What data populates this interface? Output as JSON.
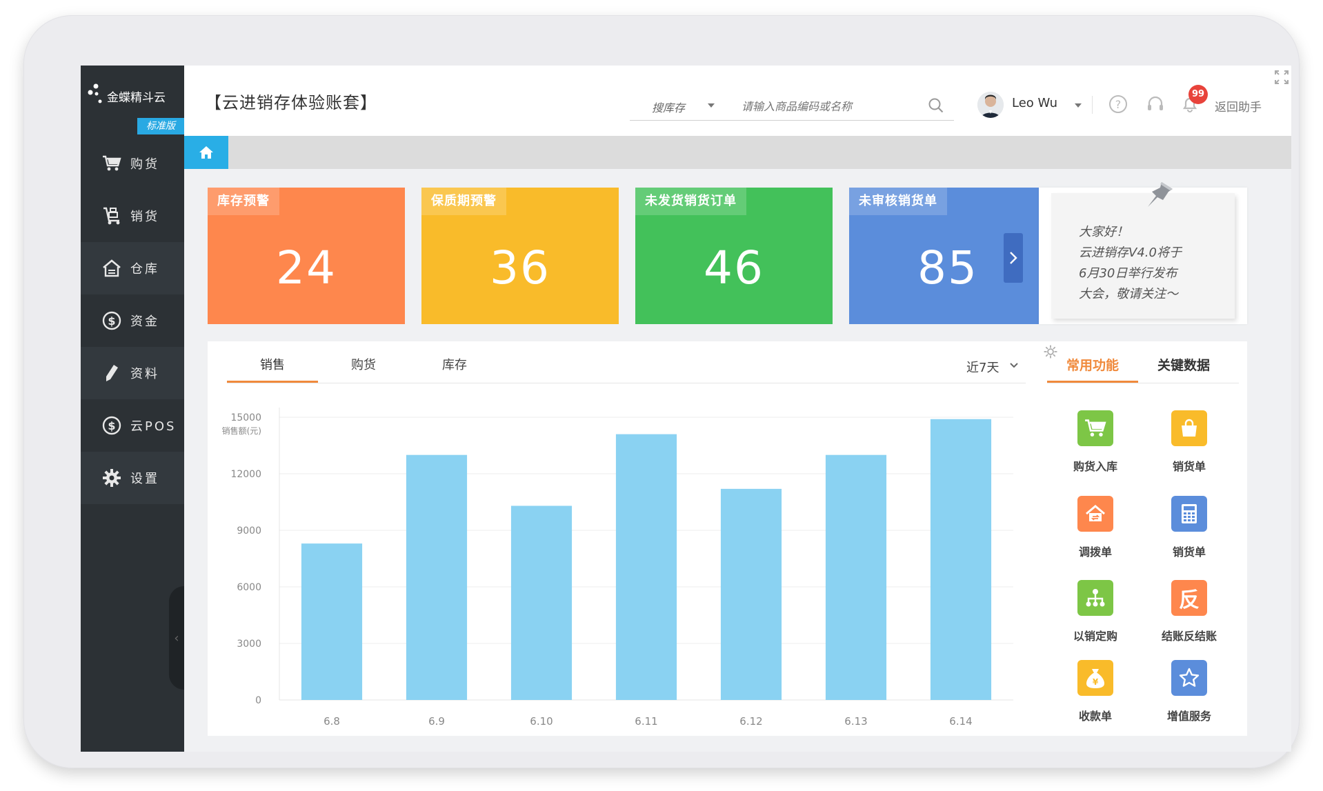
{
  "app": {
    "logo_text": "金蝶精斗云",
    "edition": "标准版",
    "title": "【云进销存体验账套】"
  },
  "sidebar": {
    "items": [
      {
        "label": "购货",
        "icon": "cart-icon"
      },
      {
        "label": "销货",
        "icon": "trolley-icon"
      },
      {
        "label": "仓库",
        "icon": "warehouse-icon"
      },
      {
        "label": "资金",
        "icon": "dollar-icon"
      },
      {
        "label": "资料",
        "icon": "pencil-icon"
      },
      {
        "label": "云POS",
        "icon": "dollar-icon"
      },
      {
        "label": "设置",
        "icon": "gear-icon"
      }
    ]
  },
  "header": {
    "search_scope": "搜库存",
    "search_placeholder": "请输入商品编码或名称",
    "user_name": "Leo Wu",
    "notification_count": "99",
    "assistant_label": "返回助手"
  },
  "cards": [
    {
      "label": "库存预警",
      "value": "24",
      "color": "#fe874d"
    },
    {
      "label": "保质期预警",
      "value": "36",
      "color": "#f9bb2a"
    },
    {
      "label": "未发货销货订单",
      "value": "46",
      "color": "#43c15a"
    },
    {
      "label": "未审核销货单",
      "value": "85",
      "color": "#5b8ddb"
    }
  ],
  "notice": {
    "lines": [
      "大家好！",
      "云进销存V4.0将于",
      "6月30日举行发布",
      "大会，敬请关注～"
    ]
  },
  "chart_tabs": [
    "销售",
    "购货",
    "库存"
  ],
  "chart_period": "近7天",
  "chart_data": {
    "type": "bar",
    "categories": [
      "6.8",
      "6.9",
      "6.10",
      "6.11",
      "6.12",
      "6.13",
      "6.14"
    ],
    "values": [
      8300,
      13000,
      10300,
      14100,
      11200,
      13000,
      14900
    ],
    "ylabel": "销售额(元)",
    "ylim": [
      0,
      15000
    ],
    "yticks": [
      0,
      3000,
      6000,
      9000,
      12000,
      15000
    ],
    "grid": true,
    "bar_color": "#8ad2f2"
  },
  "quick_panel": {
    "tabs": [
      "常用功能",
      "关键数据"
    ],
    "items": [
      {
        "label": "购货入库",
        "icon": "cart-icon",
        "color": "#7dc646"
      },
      {
        "label": "销货单",
        "icon": "bag-icon",
        "color": "#f9bb2a"
      },
      {
        "label": "调拨单",
        "icon": "house-transfer-icon",
        "color": "#fe874d"
      },
      {
        "label": "销货单",
        "icon": "calculator-icon",
        "color": "#5b8ddb"
      },
      {
        "label": "以销定购",
        "icon": "hierarchy-icon",
        "color": "#7dc646"
      },
      {
        "label": "结账反结账",
        "icon": "reverse-icon",
        "color": "#fe874d",
        "glyph": "反"
      },
      {
        "label": "收款单",
        "icon": "money-bag-icon",
        "color": "#f9bb2a"
      },
      {
        "label": "增值服务",
        "icon": "star-icon",
        "color": "#5b8ddb"
      }
    ]
  }
}
